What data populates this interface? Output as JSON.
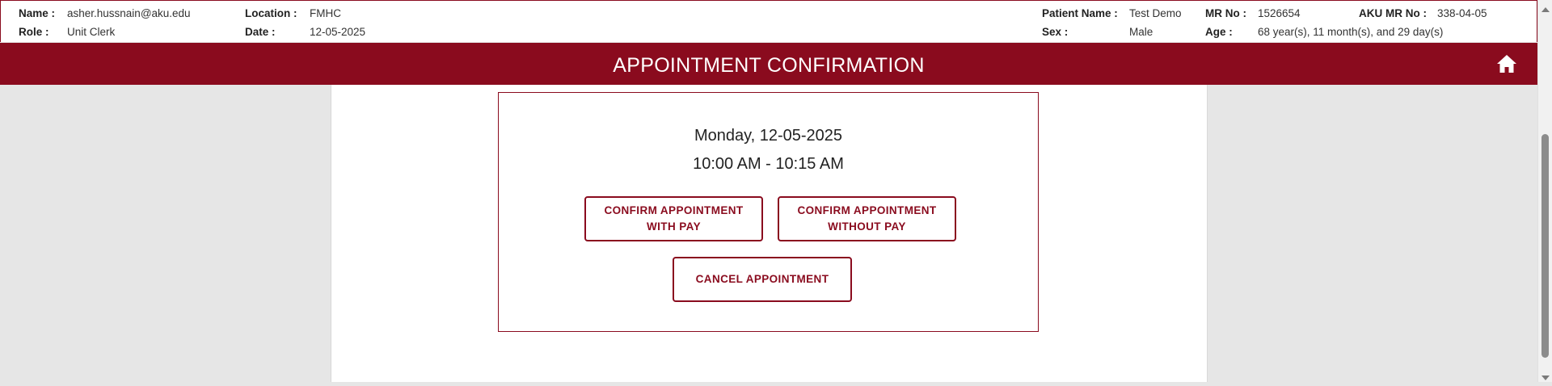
{
  "user": {
    "name_label": "Name :",
    "name_value": "asher.hussnain@aku.edu",
    "role_label": "Role :",
    "role_value": "Unit Clerk",
    "location_label": "Location :",
    "location_value": "FMHC",
    "date_label": "Date :",
    "date_value": "12-05-2025"
  },
  "patient": {
    "patient_name_label": "Patient Name :",
    "patient_name_value": "Test Demo",
    "sex_label": "Sex :",
    "sex_value": "Male",
    "mr_label": "MR No :",
    "mr_value": "1526654",
    "age_label": "Age :",
    "age_value": "68 year(s), 11 month(s), and 29 day(s)",
    "aku_mr_label": "AKU MR No :",
    "aku_mr_value": "338-04-05"
  },
  "header": {
    "title": "APPOINTMENT CONFIRMATION",
    "home_icon": "home-icon",
    "color": "#8a0b1e"
  },
  "appointment": {
    "date_text": "Monday, 12-05-2025",
    "time_text": "10:00 AM - 10:15 AM",
    "confirm_with_pay_line1": "CONFIRM APPOINTMENT",
    "confirm_with_pay_line2": "WITH PAY",
    "confirm_without_pay_line1": "CONFIRM APPOINTMENT",
    "confirm_without_pay_line2": "WITHOUT PAY",
    "cancel_label": "CANCEL APPOINTMENT"
  }
}
